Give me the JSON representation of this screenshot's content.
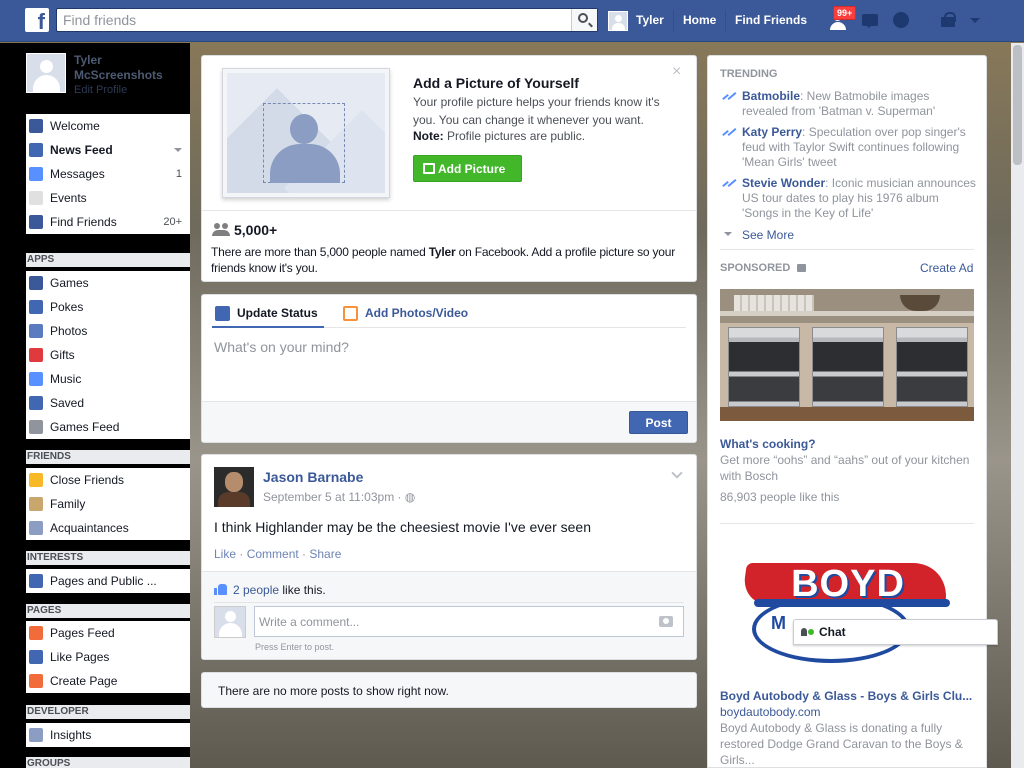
{
  "topbar": {
    "logo": "f",
    "search_placeholder": "Find friends",
    "user_name": "Tyler",
    "home": "Home",
    "find_friends": "Find Friends",
    "notification_badge": "99+"
  },
  "profile": {
    "name": "Tyler McScreenshots",
    "edit": "Edit Profile"
  },
  "sidebar": {
    "favorites": [
      {
        "label": "Welcome",
        "icon": "facebook-icon",
        "color": "#3b5998"
      },
      {
        "label": "News Feed",
        "icon": "news-feed-icon",
        "color": "#4267b2"
      },
      {
        "label": "Messages",
        "icon": "messages-icon",
        "color": "#5890ff",
        "count": "1"
      },
      {
        "label": "Events",
        "icon": "calendar-icon",
        "color": "#e0e0e0"
      },
      {
        "label": "Find Friends",
        "icon": "friends-icon",
        "color": "#3b5998",
        "count": "20+"
      }
    ],
    "apps_title": "APPS",
    "apps": [
      {
        "label": "Games",
        "icon": "games-icon",
        "color": "#3b5998"
      },
      {
        "label": "Pokes",
        "icon": "pokes-icon",
        "color": "#4267b2"
      },
      {
        "label": "Photos",
        "icon": "photos-icon",
        "color": "#5a7bbf"
      },
      {
        "label": "Gifts",
        "icon": "gift-icon",
        "color": "#e0393e"
      },
      {
        "label": "Music",
        "icon": "music-icon",
        "color": "#5890ff"
      },
      {
        "label": "Saved",
        "icon": "saved-icon",
        "color": "#4267b2"
      },
      {
        "label": "Games Feed",
        "icon": "controller-icon",
        "color": "#90949c"
      }
    ],
    "friends_title": "FRIENDS",
    "friends": [
      {
        "label": "Close Friends",
        "icon": "star-icon",
        "color": "#f7b928"
      },
      {
        "label": "Family",
        "icon": "house-icon",
        "color": "#c9a66b"
      },
      {
        "label": "Acquaintances",
        "icon": "acquaintances-icon",
        "color": "#8b9dc3"
      }
    ],
    "interests_title": "INTERESTS",
    "interests": [
      {
        "label": "Pages and Public ...",
        "icon": "rss-icon",
        "color": "#4267b2"
      }
    ],
    "pages_title": "PAGES",
    "pages": [
      {
        "label": "Pages Feed",
        "icon": "pages-feed-icon",
        "color": "#f26b3a"
      },
      {
        "label": "Like Pages",
        "icon": "like-icon",
        "color": "#4267b2"
      },
      {
        "label": "Create Page",
        "icon": "plus-icon",
        "color": "#f26b3a"
      }
    ],
    "developer_title": "DEVELOPER",
    "developer": [
      {
        "label": "Insights",
        "icon": "insights-icon",
        "color": "#8b9dc3"
      }
    ],
    "groups_title": "GROUPS"
  },
  "profile_picture_card": {
    "title": "Add a Picture of Yourself",
    "description": "Your profile picture helps your friends know it's you. You can change it whenever you want.",
    "note_label": "Note:",
    "note_text": " Profile pictures are public.",
    "button": "Add Picture",
    "close": "×",
    "count": "5,000+",
    "people_text_1": "There are more than 5,000 people named ",
    "people_name": "Tyler",
    "people_text_2": " on Facebook. Add a profile picture so your friends know it's you."
  },
  "composer": {
    "tab_status": "Update Status",
    "tab_photos": "Add Photos/Video",
    "placeholder": "What's on your mind?",
    "post_button": "Post",
    "accent": "#4267b2"
  },
  "post": {
    "author": "Jason Barnabe",
    "time": "September 5 at 11:03pm · ",
    "privacy_icon": "globe-icon",
    "text": "I think Highlander may be the cheesiest movie I've ever seen",
    "like": "Like",
    "comment": "Comment",
    "share": "Share",
    "sep": " · ",
    "likes_link": "2 people",
    "likes_suffix": " like this.",
    "comment_placeholder": "Write a comment...",
    "comment_hint": "Press Enter to post."
  },
  "feed_end": "There are no more posts to show right now.",
  "trending": {
    "title": "TRENDING",
    "items": [
      {
        "topic": "Batmobile",
        "text": ": New Batmobile images revealed from 'Batman v. Superman'"
      },
      {
        "topic": "Katy Perry",
        "text": ": Speculation over pop singer's feud with Taylor Swift continues following 'Mean Girls' tweet"
      },
      {
        "topic": "Stevie Wonder",
        "text": ": Iconic musician announces US tour dates to play his 1976 album 'Songs in the Key of Life'"
      }
    ],
    "see_more": "See More"
  },
  "sponsored": {
    "title": "SPONSORED",
    "create_ad": "Create Ad",
    "ads": [
      {
        "title": "What's cooking?",
        "description": "Get more “oohs” and “aahs” out of your kitchen with Bosch",
        "likes": "86,903 people like this"
      },
      {
        "logo_text": "BOYD",
        "logo_sub": "M",
        "title": "Boyd Autobody & Glass - Boys & Girls Clu...",
        "url": "boydautobody.com",
        "description": "Boyd Autobody & Glass is donating a fully restored Dodge Grand Caravan to the Boys & Girls..."
      }
    ]
  },
  "chat": {
    "label": "Chat"
  }
}
